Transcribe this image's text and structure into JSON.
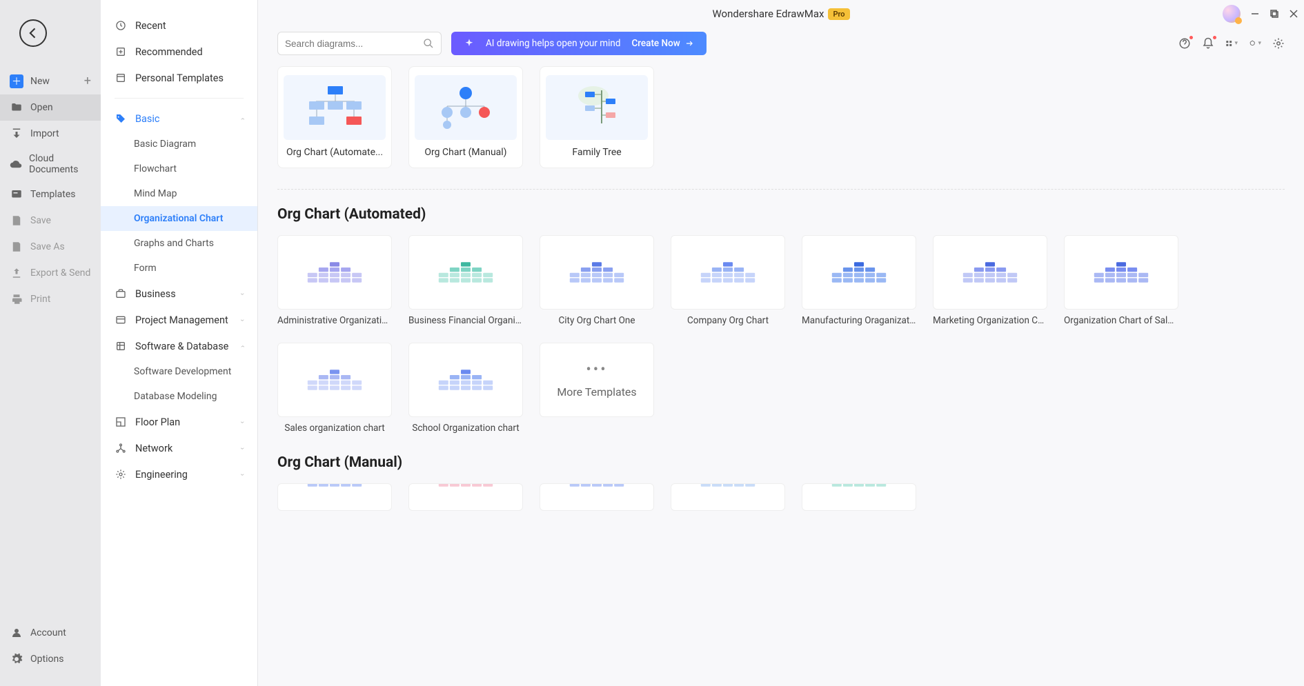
{
  "app": {
    "title": "Wondershare EdrawMax",
    "badge": "Pro"
  },
  "sidebar": {
    "back_aria": "Back",
    "items": {
      "new": "New",
      "open": "Open",
      "import": "Import",
      "cloud": "Cloud Documents",
      "templates": "Templates",
      "save": "Save",
      "saveas": "Save As",
      "export": "Export & Send",
      "print": "Print",
      "account": "Account",
      "options": "Options"
    }
  },
  "categories": {
    "recent": "Recent",
    "recommended": "Recommended",
    "personal": "Personal Templates",
    "basic": {
      "label": "Basic",
      "children": {
        "diagram": "Basic Diagram",
        "flowchart": "Flowchart",
        "mindmap": "Mind Map",
        "orgchart": "Organizational Chart",
        "graphs": "Graphs and Charts",
        "form": "Form"
      }
    },
    "business": "Business",
    "project": "Project Management",
    "software": {
      "label": "Software & Database",
      "children": {
        "dev": "Software Development",
        "db": "Database Modeling"
      }
    },
    "floor": "Floor Plan",
    "network": "Network",
    "engineering": "Engineering"
  },
  "search": {
    "placeholder": "Search diagrams..."
  },
  "ai_banner": {
    "text": "AI drawing helps open your mind",
    "cta": "Create Now"
  },
  "top_cards": [
    {
      "label": "Org Chart (Automate..."
    },
    {
      "label": "Org Chart (Manual)"
    },
    {
      "label": "Family Tree"
    }
  ],
  "sections": {
    "auto": {
      "title": "Org Chart (Automated)",
      "cards": [
        "Administrative Organizatio...",
        "Business Financial Organiz...",
        "City Org Chart One",
        "Company Org Chart",
        "Manufacturing Oraganizati...",
        "Marketing Organization Ch...",
        "Organization Chart of Sale...",
        "Sales organization chart",
        "School Organization chart"
      ],
      "more": "More Templates"
    },
    "manual": {
      "title": "Org Chart (Manual)"
    }
  }
}
